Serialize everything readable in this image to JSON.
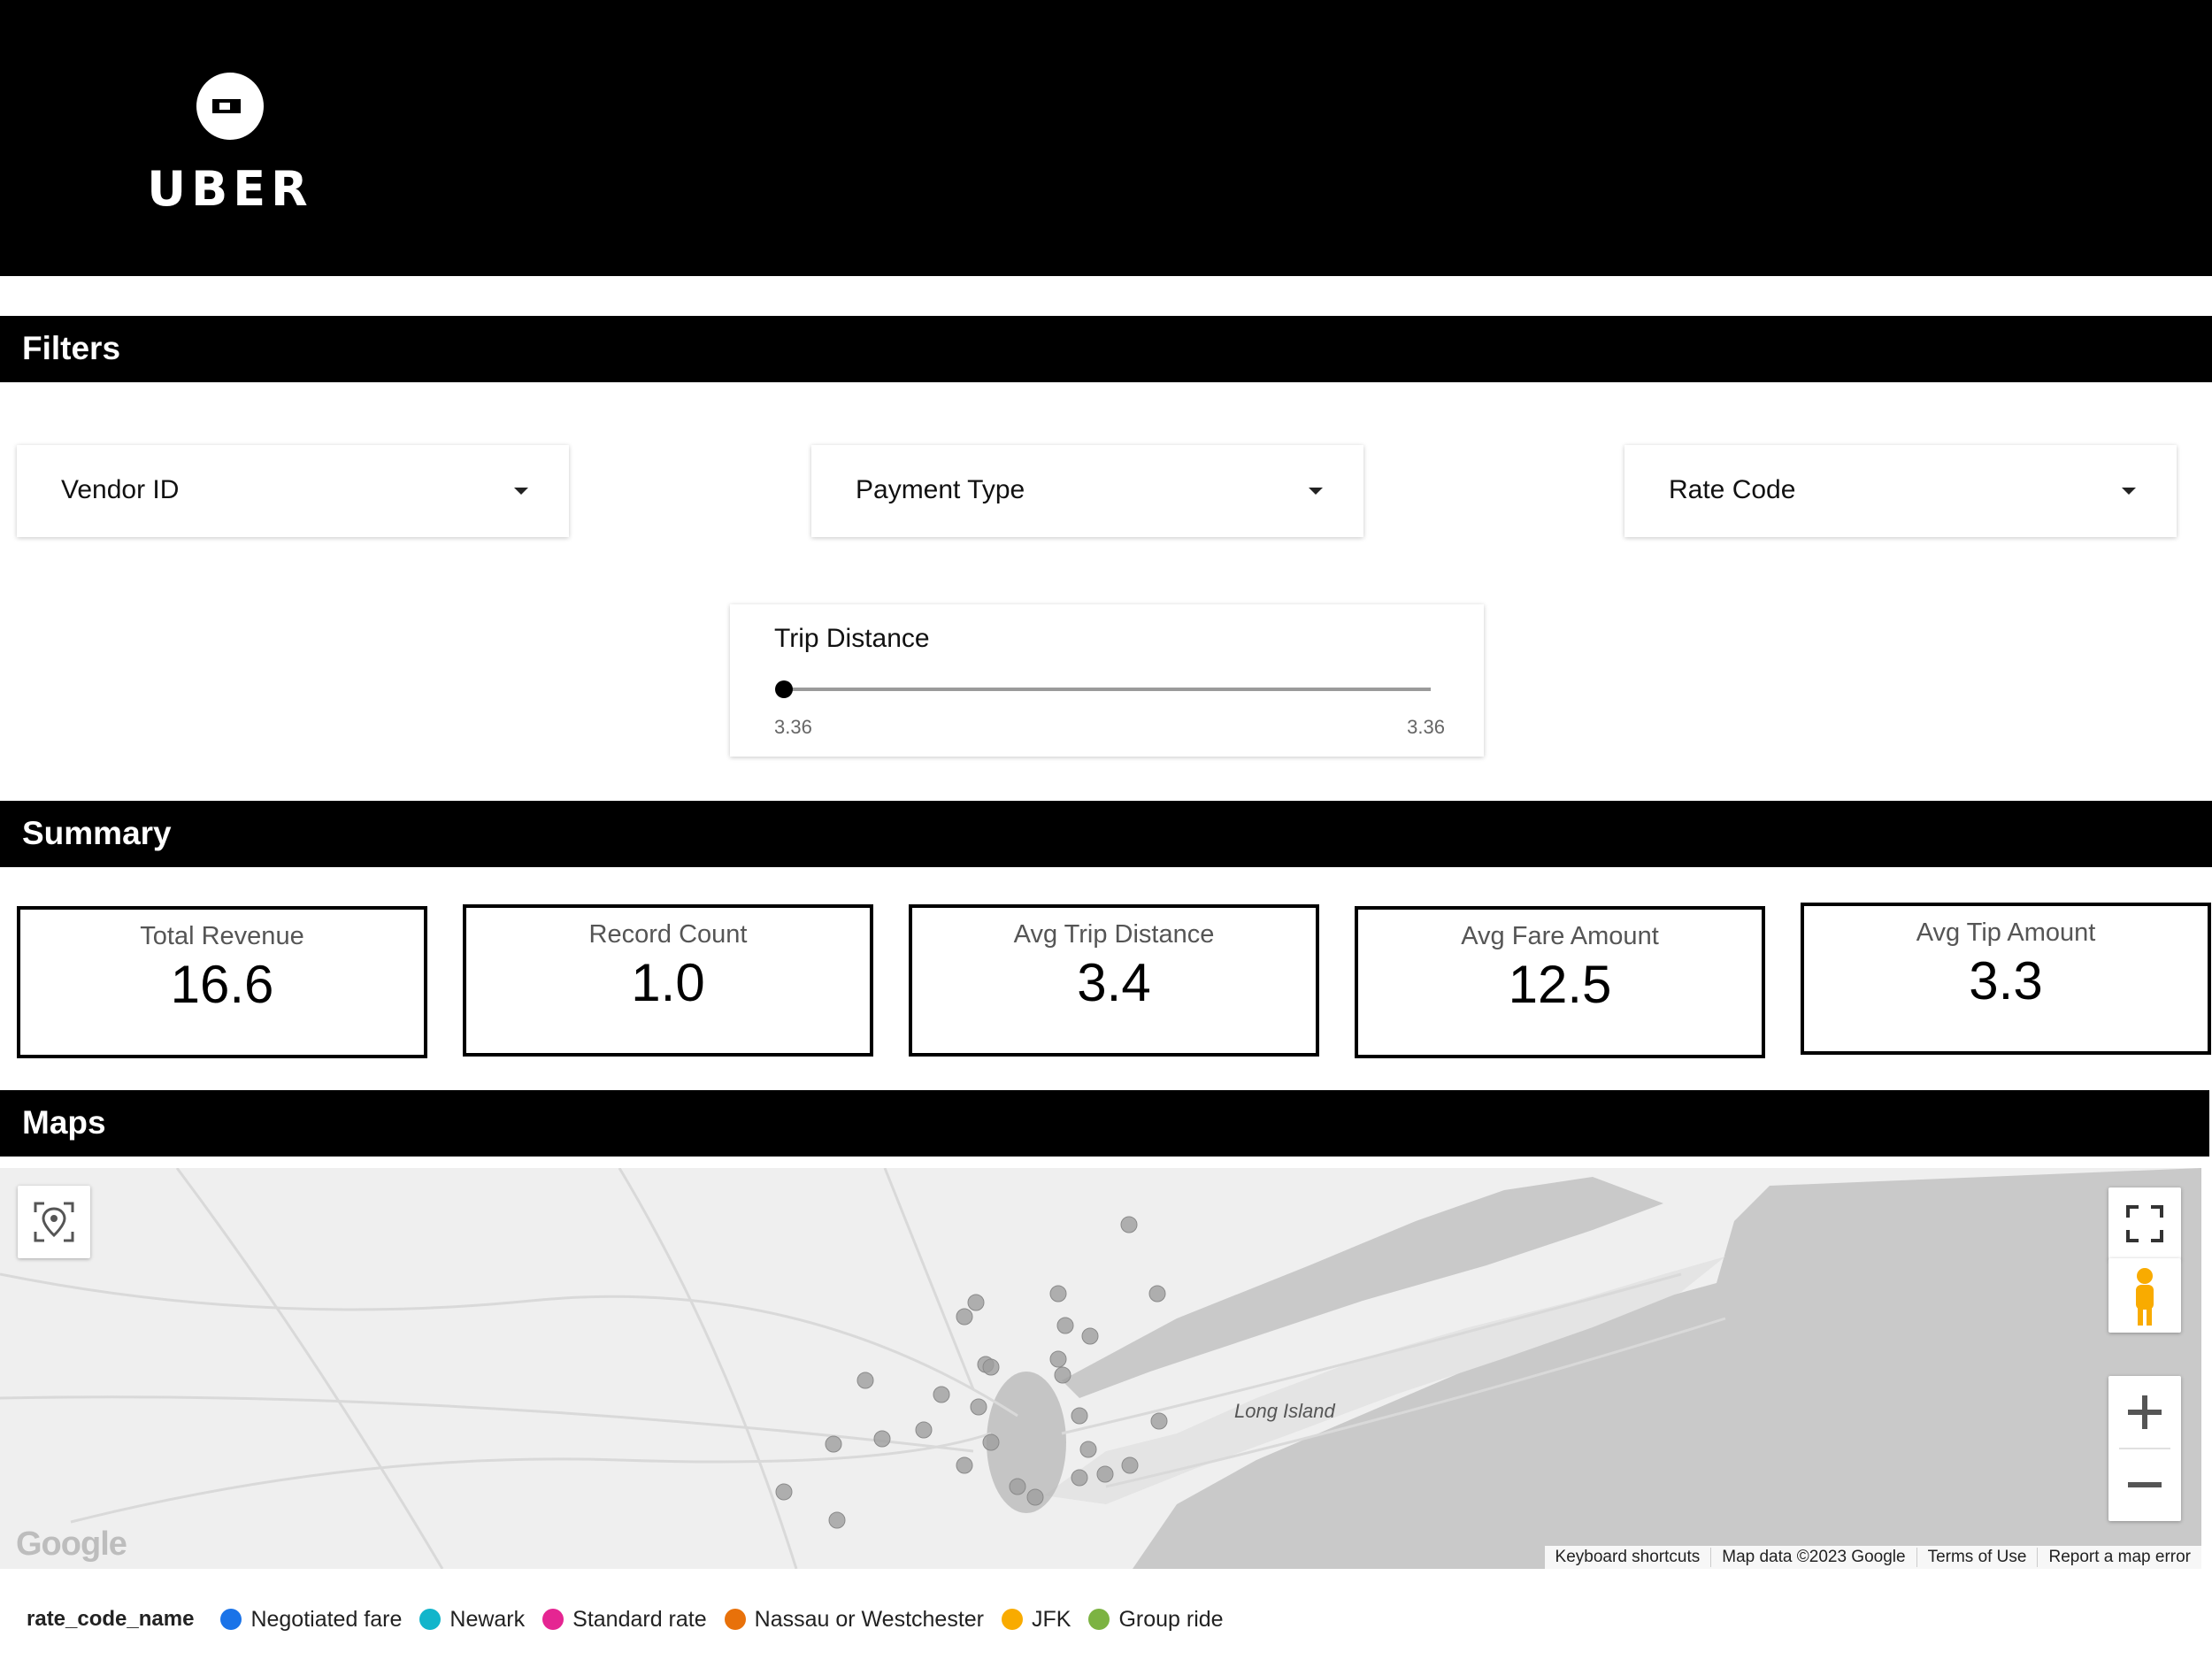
{
  "header": {
    "brand": "UBER"
  },
  "sections": {
    "filters": "Filters",
    "summary": "Summary",
    "maps": "Maps"
  },
  "filters": {
    "dropdowns": [
      {
        "label": "Vendor ID"
      },
      {
        "label": "Payment Type"
      },
      {
        "label": "Rate Code"
      }
    ],
    "slider": {
      "label": "Trip Distance",
      "min_label": "3.36",
      "max_label": "3.36"
    }
  },
  "summary": {
    "cards": [
      {
        "title": "Total Revenue",
        "value": "16.6"
      },
      {
        "title": "Record Count",
        "value": "1.0"
      },
      {
        "title": "Avg Trip Distance",
        "value": "3.4"
      },
      {
        "title": "Avg Fare Amount",
        "value": "12.5"
      },
      {
        "title": "Avg Tip Amount",
        "value": "3.3"
      }
    ]
  },
  "map": {
    "place_label": "Long Island",
    "google_logo": "Google",
    "footer": [
      "Keyboard shortcuts",
      "Map data ©2023 Google",
      "Terms of Use",
      "Report a map error"
    ]
  },
  "legend": {
    "title": "rate_code_name",
    "items": [
      {
        "label": "Negotiated fare",
        "color": "#1a73e8"
      },
      {
        "label": "Newark",
        "color": "#12b5cb"
      },
      {
        "label": "Standard rate",
        "color": "#e52592"
      },
      {
        "label": "Nassau or Westchester",
        "color": "#e8710a"
      },
      {
        "label": "JFK",
        "color": "#f9ab00"
      },
      {
        "label": "Group ride",
        "color": "#7cb342"
      }
    ]
  },
  "colors": {
    "header_bg": "#000000",
    "map_land": "#efefef",
    "map_water": "#c9c9c9",
    "point": "#9e9e9e"
  }
}
